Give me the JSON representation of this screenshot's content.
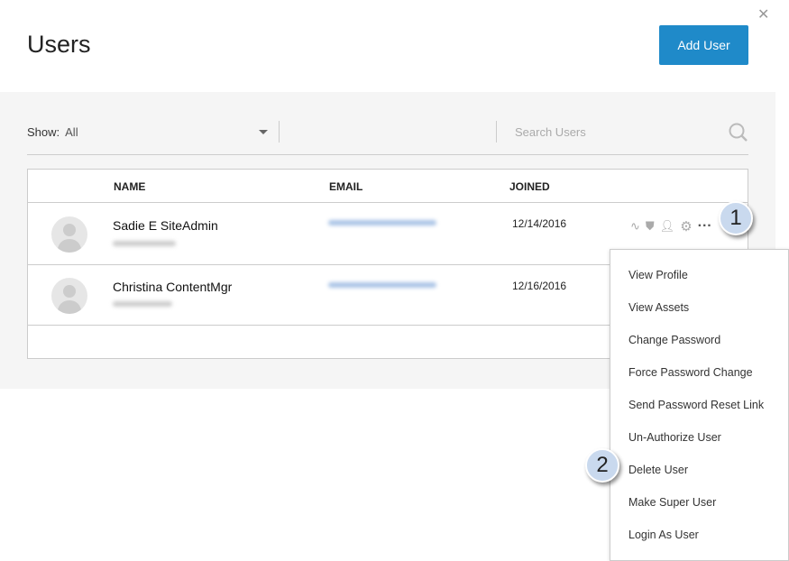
{
  "header": {
    "title": "Users",
    "add_user": "Add User"
  },
  "filter": {
    "label": "Show:",
    "value": "All"
  },
  "search": {
    "placeholder": "Search Users"
  },
  "table": {
    "columns": [
      "NAME",
      "EMAIL",
      "JOINED"
    ],
    "rows": [
      {
        "name": "Sadie E SiteAdmin",
        "joined": "12/14/2016"
      },
      {
        "name": "Christina ContentMgr",
        "joined": "12/16/2016"
      }
    ]
  },
  "callouts": [
    "1",
    "2"
  ],
  "menu": [
    "View Profile",
    "View Assets",
    "Change Password",
    "Force Password Change",
    "Send Password Reset Link",
    "Un-Authorize User",
    "Delete User",
    "Make Super User",
    "Login As User"
  ],
  "colors": {
    "accent": "#1f8ac9",
    "callout": "#c9d9ee"
  }
}
